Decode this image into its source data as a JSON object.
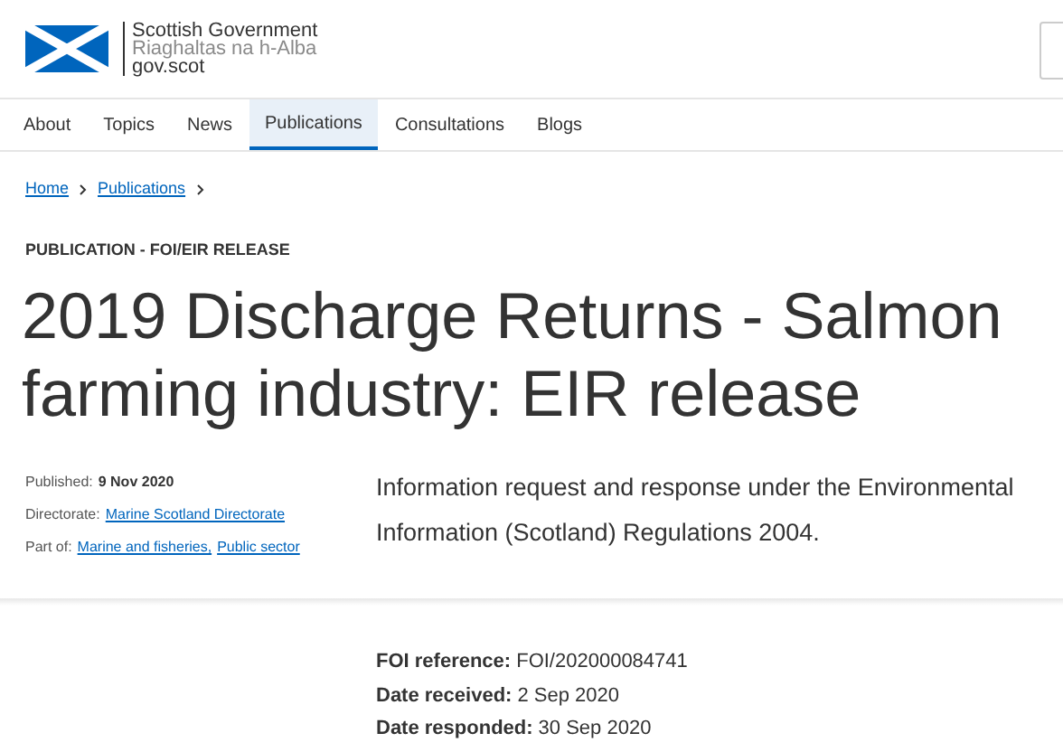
{
  "header": {
    "logo_lines": [
      "Scottish Government",
      "Riaghaltas na h-Alba",
      "gov.scot"
    ]
  },
  "nav": [
    {
      "label": "About",
      "selected": false
    },
    {
      "label": "Topics",
      "selected": false
    },
    {
      "label": "News",
      "selected": false
    },
    {
      "label": "Publications",
      "selected": true
    },
    {
      "label": "Consultations",
      "selected": false
    },
    {
      "label": "Blogs",
      "selected": false
    }
  ],
  "breadcrumb": [
    "Home",
    "Publications"
  ],
  "label": "PUBLICATION - FOI/EIR RELEASE",
  "title_lines": [
    "2019 Discharge Returns - Salmon",
    "farming industry: EIR release"
  ],
  "meta": [
    {
      "label": "Published:",
      "kind": "bold",
      "values": [
        "9 Nov 2020"
      ]
    },
    {
      "label": "Directorate:",
      "kind": "links",
      "values": [
        "Marine Scotland Directorate"
      ]
    },
    {
      "label": "Part of:",
      "kind": "links",
      "values": [
        "Marine and fisheries,",
        "Public sector"
      ]
    }
  ],
  "summary_lines": [
    "Information request and response under the Environmental",
    "Information (Scotland) Regulations 2004."
  ],
  "details": [
    {
      "label": "FOI reference:",
      "value": "FOI/202000084741"
    },
    {
      "label": "Date received:",
      "value": "2 Sep 2020"
    },
    {
      "label": "Date responded:",
      "value": "30 Sep 2020"
    }
  ]
}
